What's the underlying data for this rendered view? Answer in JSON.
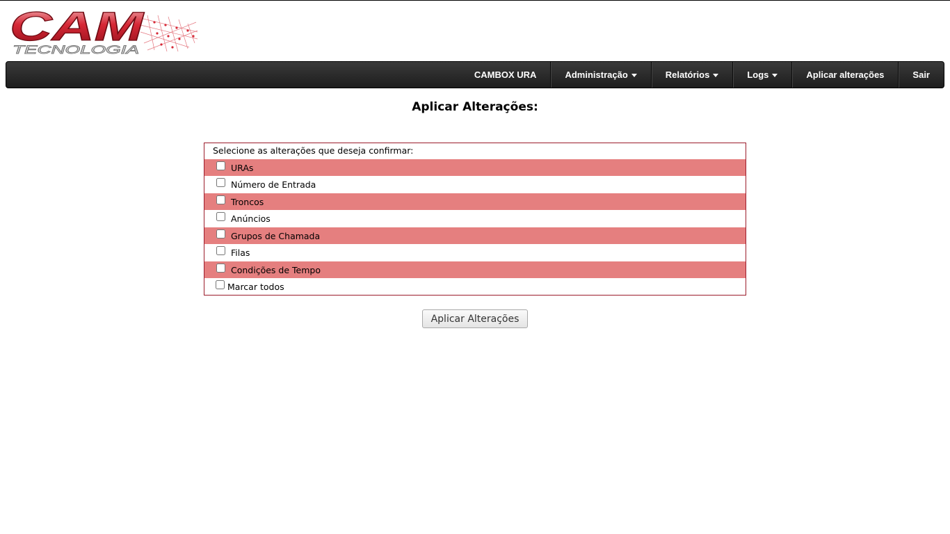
{
  "brand": {
    "logo_main": "CAM",
    "logo_sub": "TECNOLOGIA"
  },
  "nav": {
    "items": [
      {
        "label": "CAMBOX URA",
        "dropdown": false
      },
      {
        "label": "Administração",
        "dropdown": true
      },
      {
        "label": "Relatórios",
        "dropdown": true
      },
      {
        "label": "Logs",
        "dropdown": true
      },
      {
        "label": "Aplicar alterações",
        "dropdown": false
      },
      {
        "label": "Sair",
        "dropdown": false
      }
    ]
  },
  "page": {
    "title": "Aplicar Alterações:"
  },
  "form": {
    "prompt": "Selecione as alterações que deseja confirmar:",
    "options": [
      {
        "label": "URAs",
        "checked": false
      },
      {
        "label": "Número de Entrada",
        "checked": false
      },
      {
        "label": "Troncos",
        "checked": false
      },
      {
        "label": "Anúncios",
        "checked": false
      },
      {
        "label": "Grupos de Chamada",
        "checked": false
      },
      {
        "label": "Filas",
        "checked": false
      },
      {
        "label": "Condições de Tempo",
        "checked": false
      }
    ],
    "select_all": {
      "label": "Marcar todos",
      "checked": false
    },
    "submit_label": "Aplicar Alterações"
  },
  "colors": {
    "row_highlight": "#e57f7f",
    "panel_border": "#9b1b2a",
    "navbar": "#262626",
    "logo_red": "#c8202d"
  }
}
